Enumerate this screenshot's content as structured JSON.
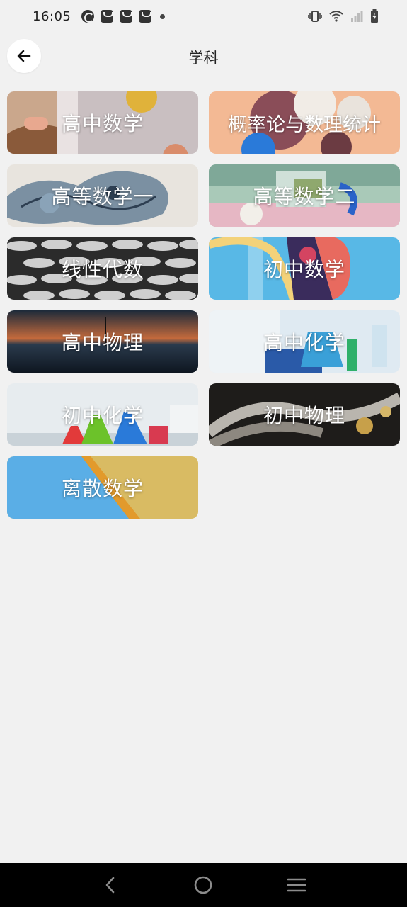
{
  "status_bar": {
    "time": "16:05",
    "notification_icons": [
      "speed-icon",
      "bag-icon",
      "bag-icon",
      "bag-icon",
      "more-dot-icon"
    ],
    "system_icons": [
      "vibrate-icon",
      "wifi-icon",
      "signal-icon",
      "battery-charging-icon"
    ]
  },
  "header": {
    "back_icon": "arrow-left-icon",
    "title": "学科"
  },
  "subjects": [
    {
      "label": "高中数学",
      "theme": "beige-pink"
    },
    {
      "label": "概率论与数理统计",
      "theme": "peach-balls"
    },
    {
      "label": "高等数学一",
      "theme": "sketch-blue"
    },
    {
      "label": "高等数学二",
      "theme": "pastel-3d"
    },
    {
      "label": "线性代数",
      "theme": "scales-gray"
    },
    {
      "label": "初中数学",
      "theme": "sky-blue"
    },
    {
      "label": "高中物理",
      "theme": "sunset-sea"
    },
    {
      "label": "高中化学",
      "theme": "lab-blue"
    },
    {
      "label": "初中化学",
      "theme": "flasks-color"
    },
    {
      "label": "初中物理",
      "theme": "engine-metal"
    },
    {
      "label": "离散数学",
      "theme": "blue-yellow"
    }
  ],
  "nav_bar": {
    "back": "nav-back-icon",
    "home": "nav-home-icon",
    "menu": "nav-menu-icon"
  },
  "colors": {
    "background": "#f1f1f1",
    "nav_bar": "#000000",
    "card_text": "#ffffff"
  }
}
